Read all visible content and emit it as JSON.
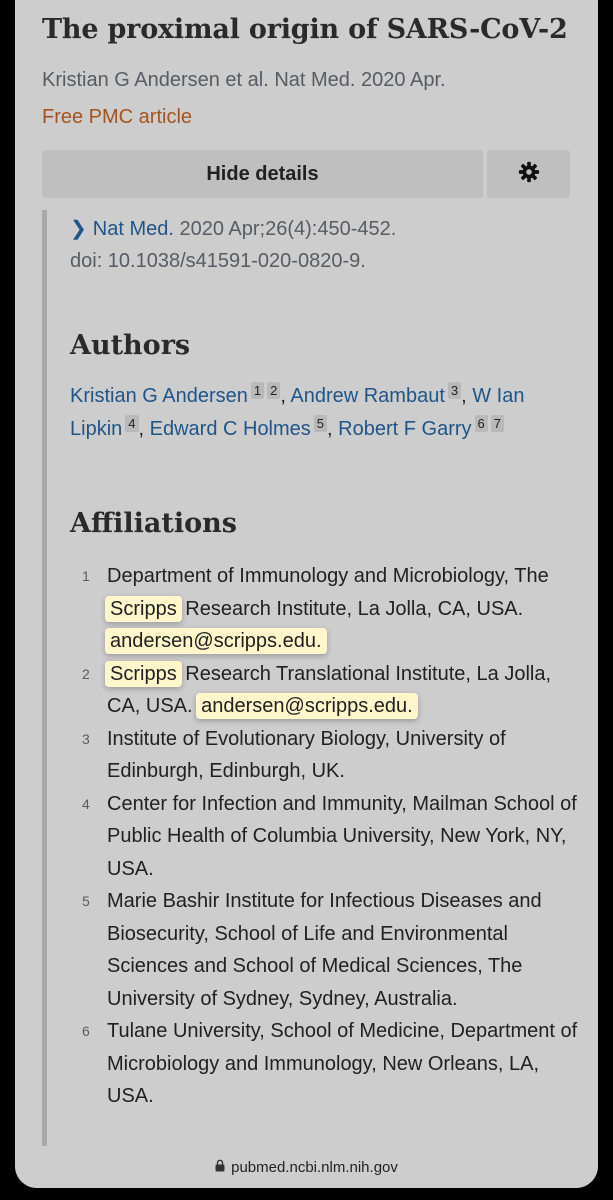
{
  "article": {
    "title": "The proximal origin of SARS-CoV-2",
    "citation": "Kristian G Andersen et al. Nat Med. 2020 Apr.",
    "free_pmc": "Free PMC article"
  },
  "toolbar": {
    "hide_details_label": "Hide details",
    "settings_icon": "gear-icon"
  },
  "details": {
    "journal_link": "Nat Med.",
    "journal_info": "2020 Apr;26(4):450-452.",
    "doi": "doi: 10.1038/s41591-020-0820-9."
  },
  "authors_heading": "Authors",
  "authors": [
    {
      "name": "Kristian G Andersen",
      "refs": [
        "1",
        "2"
      ],
      "sep": ","
    },
    {
      "name": "Andrew Rambaut",
      "refs": [
        "3"
      ],
      "sep": ","
    },
    {
      "name": "W Ian Lipkin",
      "refs": [
        "4"
      ],
      "sep": ","
    },
    {
      "name": "Edward C Holmes",
      "refs": [
        "5"
      ],
      "sep": ","
    },
    {
      "name": "Robert F Garry",
      "refs": [
        "6",
        "7"
      ],
      "sep": ""
    }
  ],
  "affiliations_heading": "Affiliations",
  "affiliations": [
    {
      "num": "1",
      "parts": [
        {
          "t": "Department of Immunology and Microbiology, The "
        },
        {
          "t": "Scripps",
          "hl": true
        },
        {
          "t": " Research Institute, La Jolla, CA, USA. "
        },
        {
          "t": "andersen@scripps.edu.",
          "hl": true
        }
      ]
    },
    {
      "num": "2",
      "parts": [
        {
          "t": "Scripps",
          "hl": true
        },
        {
          "t": " Research Translational Institute, La Jolla, CA, USA. "
        },
        {
          "t": "andersen@scripps.edu.",
          "hl": true
        }
      ]
    },
    {
      "num": "3",
      "parts": [
        {
          "t": "Institute of Evolutionary Biology, University of Edinburgh, Edinburgh, UK."
        }
      ]
    },
    {
      "num": "4",
      "parts": [
        {
          "t": "Center for Infection and Immunity, Mailman School of Public Health of Columbia University, New York, NY, USA."
        }
      ]
    },
    {
      "num": "5",
      "parts": [
        {
          "t": "Marie Bashir Institute for Infectious Diseases and Biosecurity, School of Life and Environmental Sciences and School of Medical Sciences, The University of Sydney, Sydney, Australia."
        }
      ]
    },
    {
      "num": "6",
      "parts": [
        {
          "t": "Tulane University, School of Medicine, Department of Microbiology and Immunology, New Orleans, LA, USA."
        }
      ]
    }
  ],
  "browser": {
    "url": "pubmed.ncbi.nlm.nih.gov",
    "lock_icon": "lock-icon"
  },
  "colors": {
    "link": "#20558a",
    "free_pmc": "#a5531d",
    "highlight": "#fff6cc",
    "background": "#cdcdcd"
  }
}
